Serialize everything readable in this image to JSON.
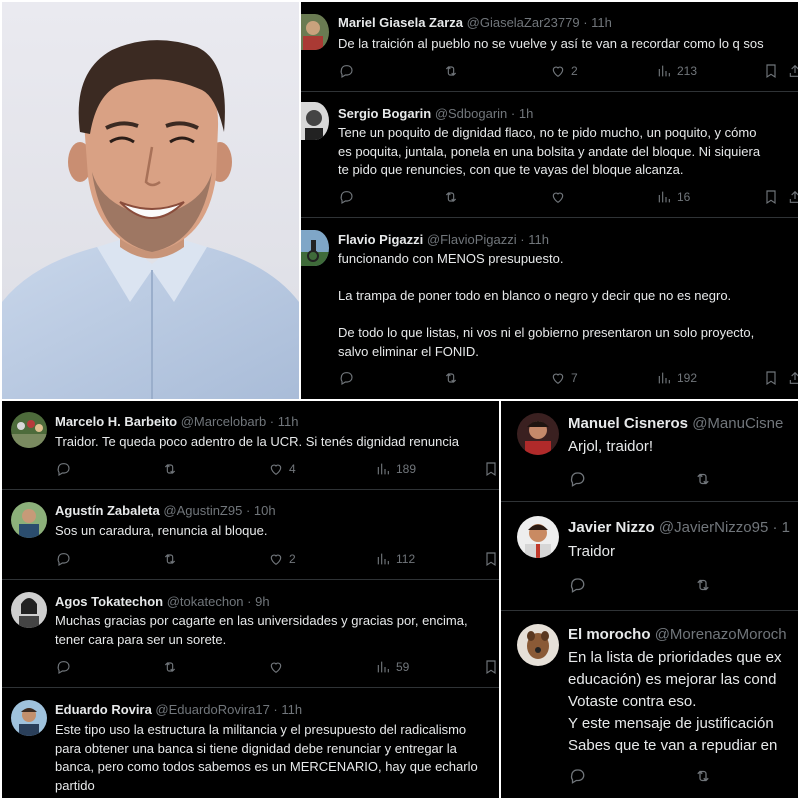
{
  "panel1": [
    {
      "name": "Mariel Giasela Zarza",
      "handle": "@GiaselaZar23779",
      "time": "· 11h",
      "lines": [
        "De la traición al pueblo no se vuelve y así te van a recordar como lo q sos"
      ],
      "likes": "2",
      "views": "213"
    },
    {
      "name": "Sergio Bogarin",
      "handle": "@Sdbogarin",
      "time": "· 1h",
      "lines": [
        "Tene un poquito de dignidad flaco, no te pido mucho, un poquito, y cómo",
        "es poquita, juntala, ponela en una bolsita y andate del bloque. Ni siquiera",
        "te pido que renuncies, con que te vayas del bloque alcanza."
      ],
      "likes": "",
      "views": "16"
    },
    {
      "name": "Flavio Pigazzi",
      "handle": "@FlavioPigazzi",
      "time": "· 11h",
      "lines": [
        "funcionando con MENOS presupuesto.",
        "La trampa de poner todo en blanco o negro y decir que no es negro.",
        "De todo lo que listas, ni vos ni el gobierno presentaron un solo proyecto,",
        "salvo eliminar el FONID."
      ],
      "likes": "7",
      "views": "192"
    }
  ],
  "panel2": [
    {
      "name": "Marcelo H. Barbeito",
      "handle": "@Marcelobarb",
      "time": "· 11h",
      "lines": [
        "Traidor. Te queda poco adentro de la UCR. Si tenés dignidad renuncia"
      ],
      "likes": "4",
      "views": "189"
    },
    {
      "name": "Agustín Zabaleta",
      "handle": "@AgustinZ95",
      "time": "· 10h",
      "lines": [
        "Sos un caradura, renuncia al bloque."
      ],
      "likes": "2",
      "views": "112"
    },
    {
      "name": "Agos Tokatechon",
      "handle": "@tokatechon",
      "time": "· 9h",
      "lines": [
        "Muchas gracias por cagarte en las universidades y gracias por, encima,",
        "tener cara para ser un sorete."
      ],
      "likes": "",
      "views": "59"
    },
    {
      "name": "Eduardo Rovira",
      "handle": "@EduardoRovira17",
      "time": "· 11h",
      "lines": [
        "Este tipo uso la estructura la militancia y el presupuesto del radicalismo",
        "para obtener una banca si tiene dignidad debe renunciar y entregar la",
        "banca, pero como todos sabemos es un MERCENARIO, hay que echarlo",
        "partido"
      ]
    }
  ],
  "panel3": [
    {
      "name": "Manuel Cisneros",
      "handle": "@ManuCisne",
      "time": "",
      "lines": [
        "Arjol, traidor!"
      ]
    },
    {
      "name": "Javier Nizzo",
      "handle": "@JavierNizzo95",
      "time": "· 1",
      "lines": [
        "Traidor"
      ]
    },
    {
      "name": "El morocho",
      "handle": "@MorenazoMoroch",
      "time": "",
      "lines": [
        "En la lista de prioridades que ex",
        "educación) es mejorar las cond",
        "Votaste contra eso.",
        "Y este mensaje de justificación",
        "Sabes que te van a repudiar en"
      ]
    }
  ]
}
